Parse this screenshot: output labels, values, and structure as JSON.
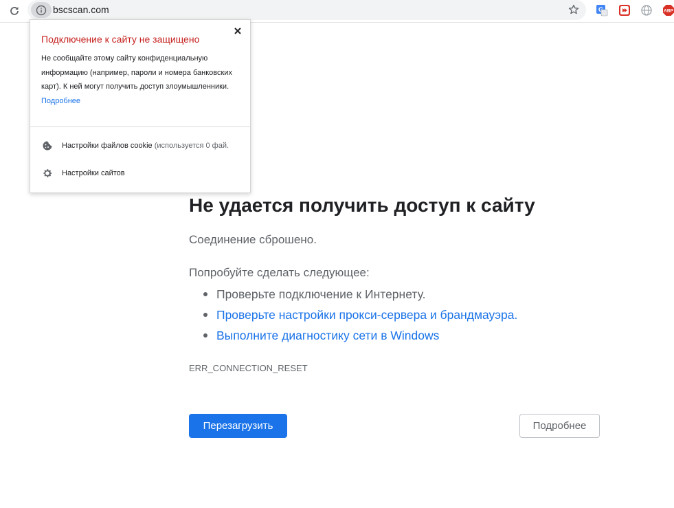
{
  "toolbar": {
    "url": "bscscan.com",
    "extensions": {
      "abp_label": "ABP"
    }
  },
  "popup": {
    "title": "Подключение к сайту не защищено",
    "body": "Не сообщайте этому сайту конфиденциальную информацию (например, пароли и номера банковских карт). К ней могут получить доступ злоумышленники.",
    "link": "Подробнее",
    "cookie_label": "Настройки файлов cookie",
    "cookie_note": "(используется 0 фай.",
    "sites_label": "Настройки сайтов"
  },
  "error": {
    "heading": "Не удается получить доступ к сайту",
    "subtext": "Соединение сброшено.",
    "try_title": "Попробуйте сделать следующее:",
    "suggestions": [
      "Проверьте подключение к Интернету.",
      "Проверьте настройки прокси-сервера и брандмауэра.",
      "Выполните диагностику сети в Windows"
    ],
    "code": "ERR_CONNECTION_RESET",
    "reload_label": "Перезагрузить",
    "details_label": "Подробнее"
  },
  "colors": {
    "accent": "#1a73e8",
    "warning": "#c5221f",
    "text": "#202124",
    "muted": "#5f6368"
  },
  "icons": [
    "reload-icon",
    "info-icon",
    "star-icon",
    "translate-icon",
    "video-icon",
    "globe-icon",
    "abp-icon",
    "close-icon",
    "cookie-icon",
    "gear-icon"
  ]
}
